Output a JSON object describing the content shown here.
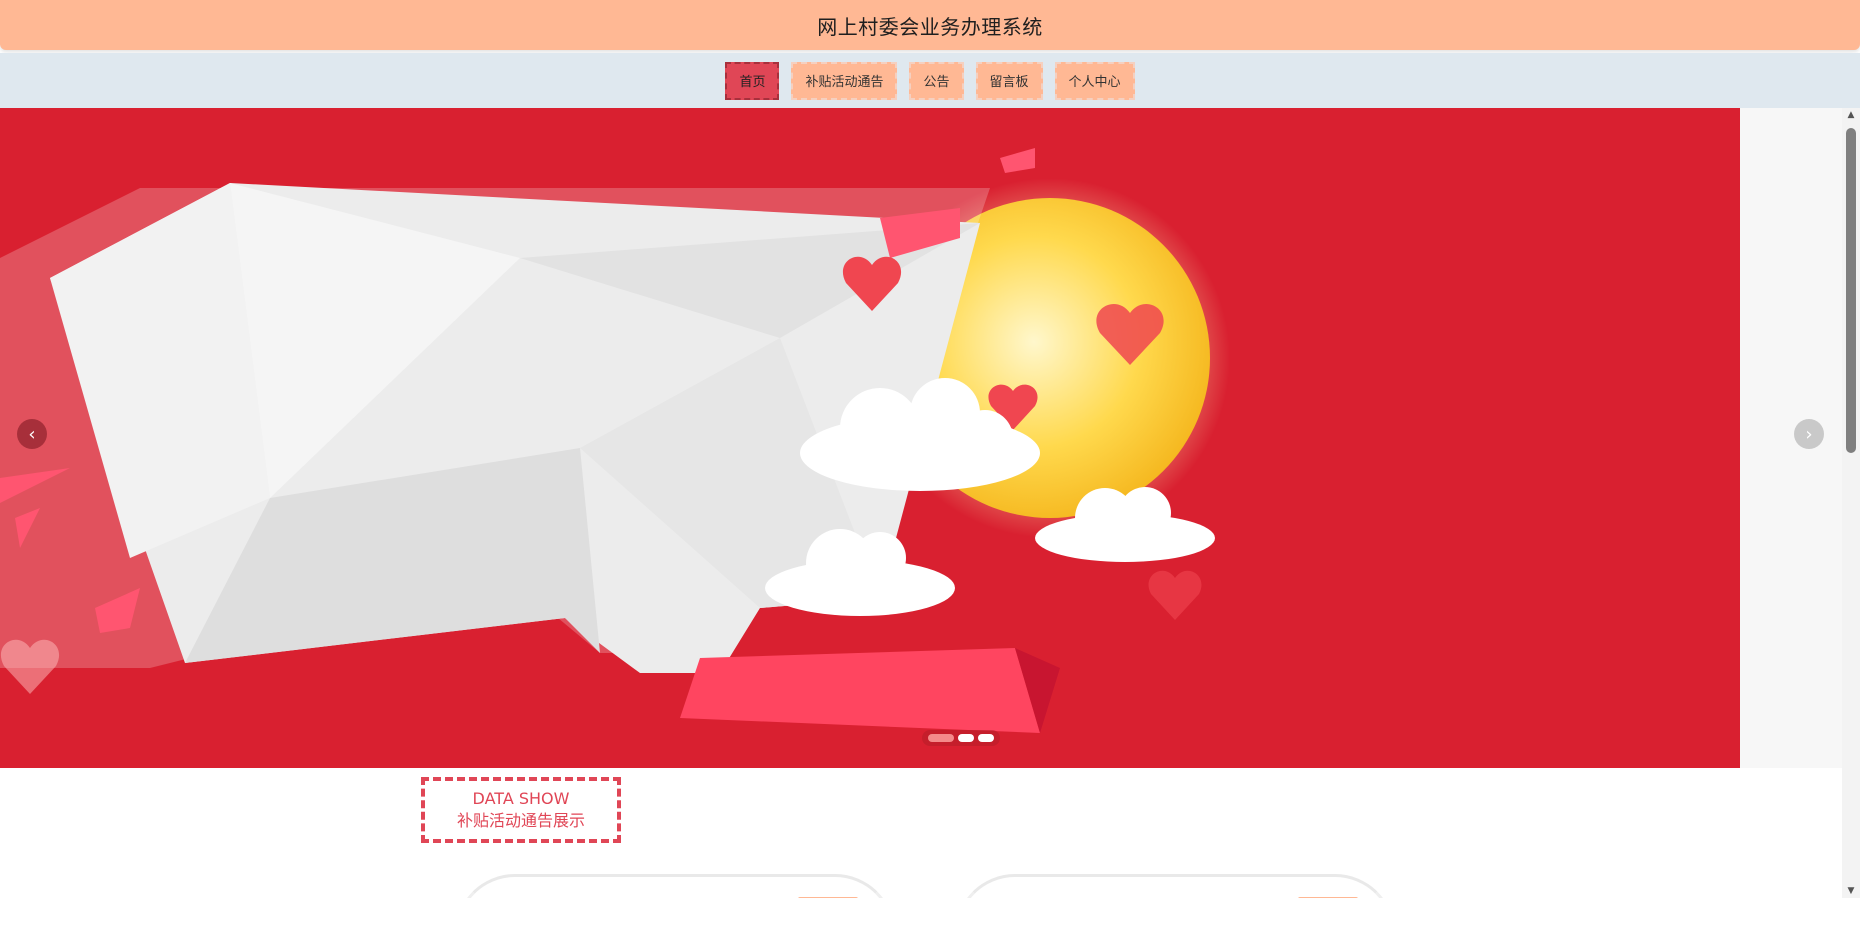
{
  "header": {
    "title": "网上村委会业务办理系统"
  },
  "nav": {
    "items": [
      {
        "label": "首页",
        "active": true
      },
      {
        "label": "补贴活动通告",
        "active": false
      },
      {
        "label": "公告",
        "active": false
      },
      {
        "label": "留言板",
        "active": false
      },
      {
        "label": "个人中心",
        "active": false
      }
    ]
  },
  "carousel": {
    "prev_icon": "chevron-left-icon",
    "next_icon": "chevron-right-icon",
    "slides_count": 3,
    "active_index": 0
  },
  "section": {
    "title_en": "DATA SHOW",
    "title_cn": "补贴活动通告展示"
  },
  "colors": {
    "header_bg": "#ffb894",
    "nav_bg": "#dfe8ef",
    "accent": "#e04656",
    "banner_red": "#d92030"
  }
}
